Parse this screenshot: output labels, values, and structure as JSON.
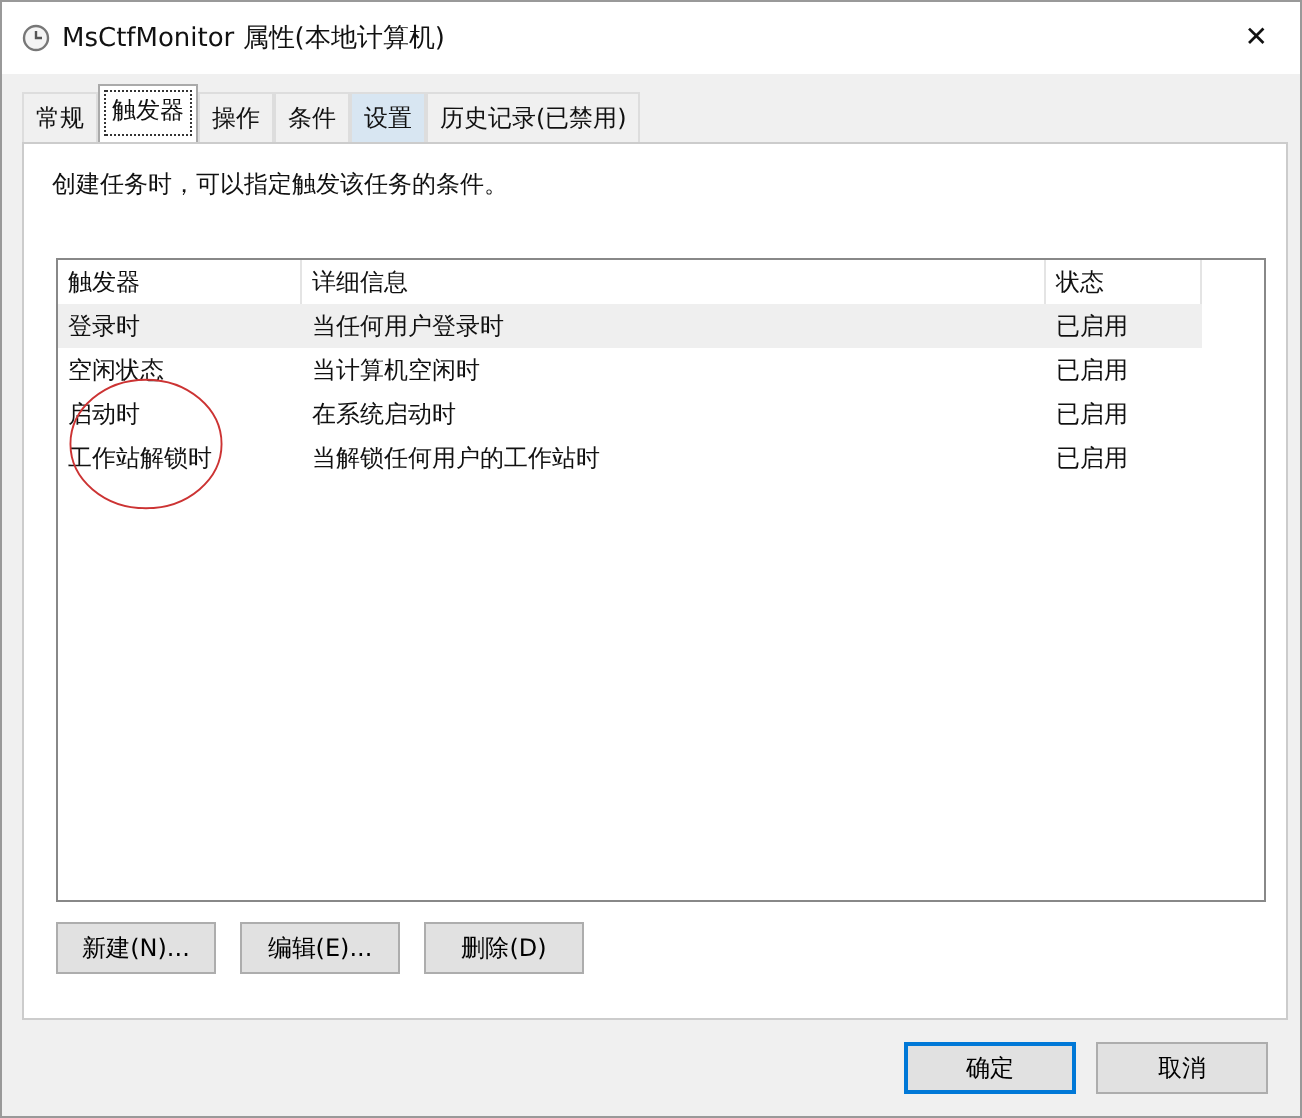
{
  "window": {
    "title": "MsCtfMonitor 属性(本地计算机)",
    "close": "✕"
  },
  "tabs": [
    {
      "label": "常规",
      "selected": false,
      "hover": false
    },
    {
      "label": "触发器",
      "selected": true,
      "hover": false
    },
    {
      "label": "操作",
      "selected": false,
      "hover": false
    },
    {
      "label": "条件",
      "selected": false,
      "hover": false
    },
    {
      "label": "设置",
      "selected": false,
      "hover": true
    },
    {
      "label": "历史记录(已禁用)",
      "selected": false,
      "hover": false
    }
  ],
  "description": "创建任务时，可以指定触发该任务的条件。",
  "table": {
    "columns": [
      "触发器",
      "详细信息",
      "状态"
    ],
    "rows": [
      {
        "cells": [
          "登录时",
          "当任何用户登录时",
          "已启用"
        ],
        "selected": true
      },
      {
        "cells": [
          "空闲状态",
          "当计算机空闲时",
          "已启用"
        ],
        "selected": false
      },
      {
        "cells": [
          "启动时",
          "在系统启动时",
          "已启用"
        ],
        "selected": false
      },
      {
        "cells": [
          "工作站解锁时",
          "当解锁任何用户的工作站时",
          "已启用"
        ],
        "selected": false
      }
    ]
  },
  "actions": [
    "新建(N)...",
    "编辑(E)...",
    "删除(D)"
  ],
  "footer_buttons": [
    {
      "label": "确定",
      "default": true
    },
    {
      "label": "取消",
      "default": false
    }
  ]
}
